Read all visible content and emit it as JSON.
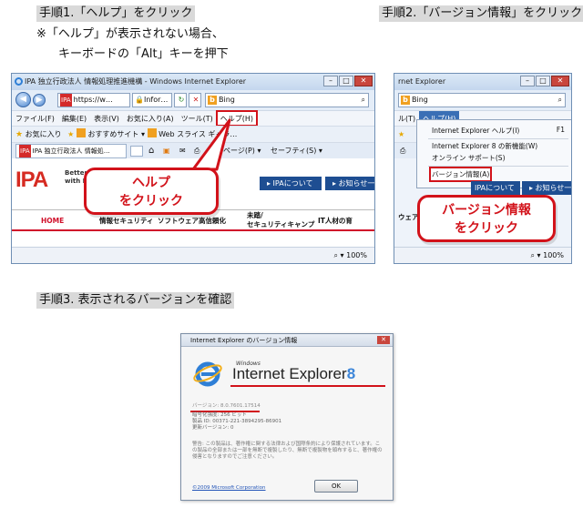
{
  "step1": {
    "heading": "手順1.「ヘルプ」をクリック",
    "note_line1": "※「ヘルプ」が表示されない場合、",
    "note_line2": "キーボードの「Alt」キーを押下"
  },
  "step2": {
    "heading": "手順2.「バージョン情報」をクリック"
  },
  "step3": {
    "heading": "手順3. 表示されるバージョンを確認"
  },
  "window1": {
    "title": "IPA 独立行政法人 情報処理推進機構 - Windows Internet Explorer",
    "url_tag": "IPA",
    "url": "https://w…",
    "info_tab": "Infor…",
    "search_text": "Bing",
    "menu": [
      "ファイル(F)",
      "編集(E)",
      "表示(V)",
      "お気に入り(A)",
      "ツール(T)",
      "ヘルプ(H)"
    ],
    "fav_label": "お気に入り",
    "fav_items": [
      "おすすめサイト ▾",
      "Web スライス ギャラ…"
    ],
    "tab_label": "IPA 独立行政法人 情報処…",
    "cmd_items": [
      "ページ(P) ▾",
      "セーフティ(S) ▾"
    ],
    "logo": "IPA",
    "logo_sub1": "Better L",
    "logo_sub2": "with I",
    "btn_about": "▸ IPAについて",
    "btn_news": "▸ お知らせ一",
    "nav": [
      "HOME",
      "情報セキュリティ",
      "ソフトウェア高信頼化",
      "未踏/",
      "セキュリティキャンプ",
      "IT人材の育"
    ],
    "zoom": "100%"
  },
  "window2": {
    "title": "rnet Explorer",
    "search_text": "Bing",
    "menu_left": "ル(T)",
    "menu_help": "ヘルプ(H)",
    "items": [
      "Internet Explorer ヘルプ(I)",
      "Internet Explorer 8 の新機能(W)",
      "オンライン サポート(S)",
      "バージョン情報(A)"
    ],
    "shortcut": "F1",
    "btn_about": "IPAについて",
    "btn_news": "▸ お知らせ一",
    "nav_frag": "ウェア高",
    "zoom": "100%"
  },
  "callouts": {
    "help": [
      "ヘルプ",
      "をクリック"
    ],
    "version": [
      "バージョン情報",
      "をクリック"
    ]
  },
  "about": {
    "title": "Internet Explorer のバージョン情報",
    "windows": "Windows",
    "brand": "Internet Explorer",
    "brand_version": "8",
    "version_line": "バージョン: 8.0.7601.17514",
    "cipher_line": "暗号化強度: 256 ビット",
    "product_id": "製品 ID: 00371-221-3894295-86901",
    "update": "更新バージョン: 0",
    "warning": "警告: この製品は、著作権に関する法律および国際条約により保護されています。この製品の全部または一部を無断で複製したり、無断で複製物を頒布すると、著作権の侵害となりますのでご注意ください。",
    "copyright": "©2009 Microsoft Corporation",
    "ok": "OK"
  },
  "colors": {
    "callout_red": "#d2121a",
    "heading_bg": "#d9d9d9",
    "ipa_red": "#d62b22",
    "ipa_blue": "#1e4e92"
  }
}
